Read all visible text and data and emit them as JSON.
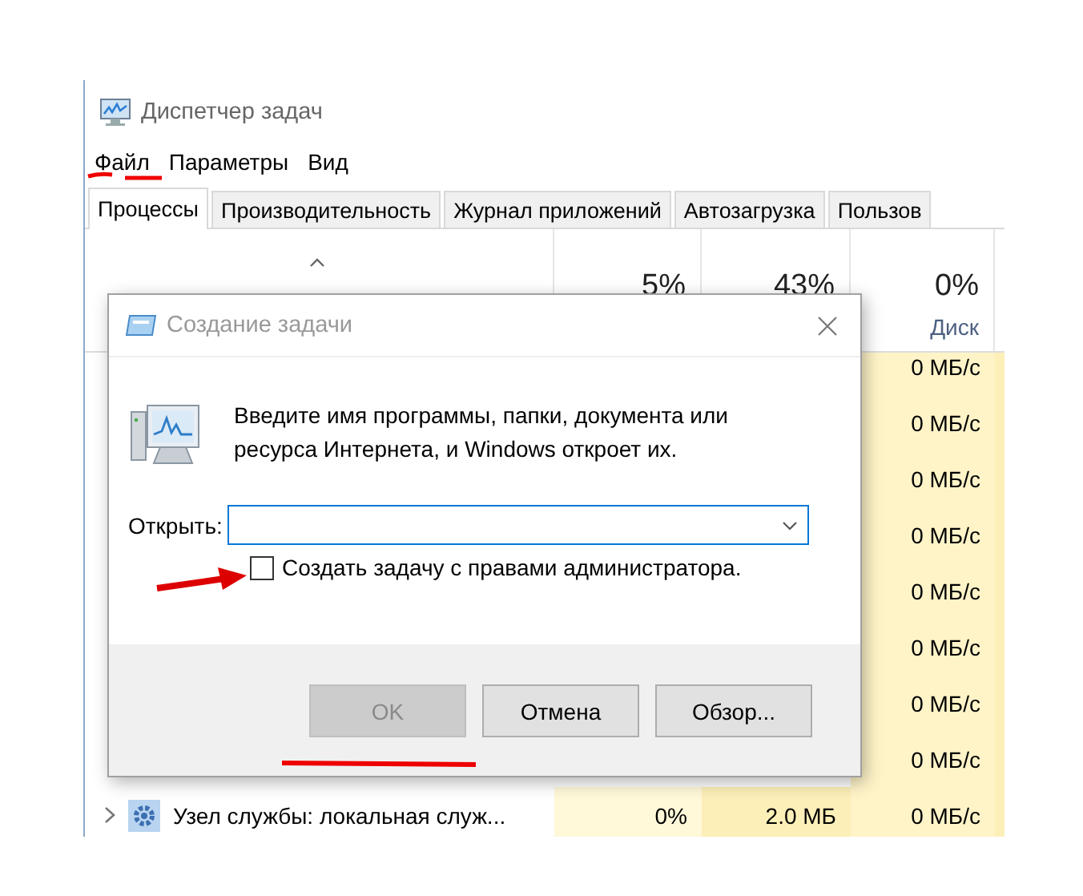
{
  "window": {
    "title": "Диспетчер задач"
  },
  "menu": [
    {
      "label": "Файл"
    },
    {
      "label": "Параметры"
    },
    {
      "label": "Вид"
    }
  ],
  "tabs": [
    {
      "label": "Процессы",
      "selected": true
    },
    {
      "label": "Производительность",
      "selected": false
    },
    {
      "label": "Журнал приложений",
      "selected": false
    },
    {
      "label": "Автозагрузка",
      "selected": false
    },
    {
      "label": "Пользов",
      "selected": false
    }
  ],
  "header": {
    "cpu": "5%",
    "memory": "43%",
    "disk_percent": "0%",
    "disk_label": "Диск"
  },
  "rows": [
    {
      "disk": "0 МБ/с"
    },
    {
      "disk": "0 МБ/с"
    },
    {
      "disk": "0 МБ/с"
    },
    {
      "disk": "0 МБ/с"
    },
    {
      "disk": "0 МБ/с"
    },
    {
      "disk": "0 МБ/с"
    },
    {
      "disk": "0 МБ/с"
    },
    {
      "disk": "0 МБ/с"
    },
    {
      "name": "Узел службы: локальная служ...",
      "cpu": "0%",
      "memory": "2.0 МБ",
      "disk": "0 МБ/с",
      "expandable": true
    }
  ],
  "dialog": {
    "title": "Создание задачи",
    "message": "Введите имя программы, папки, документа или\nресурса Интернета, и Windows откроет их.",
    "open_label": "Открыть:",
    "admin_checkbox": {
      "label": "Создать задачу с правами администратора.",
      "checked": false
    },
    "buttons": [
      {
        "label": "OK",
        "disabled": true
      },
      {
        "label": "Отмена",
        "disabled": false
      },
      {
        "label": "Обзор...",
        "disabled": false
      }
    ]
  }
}
